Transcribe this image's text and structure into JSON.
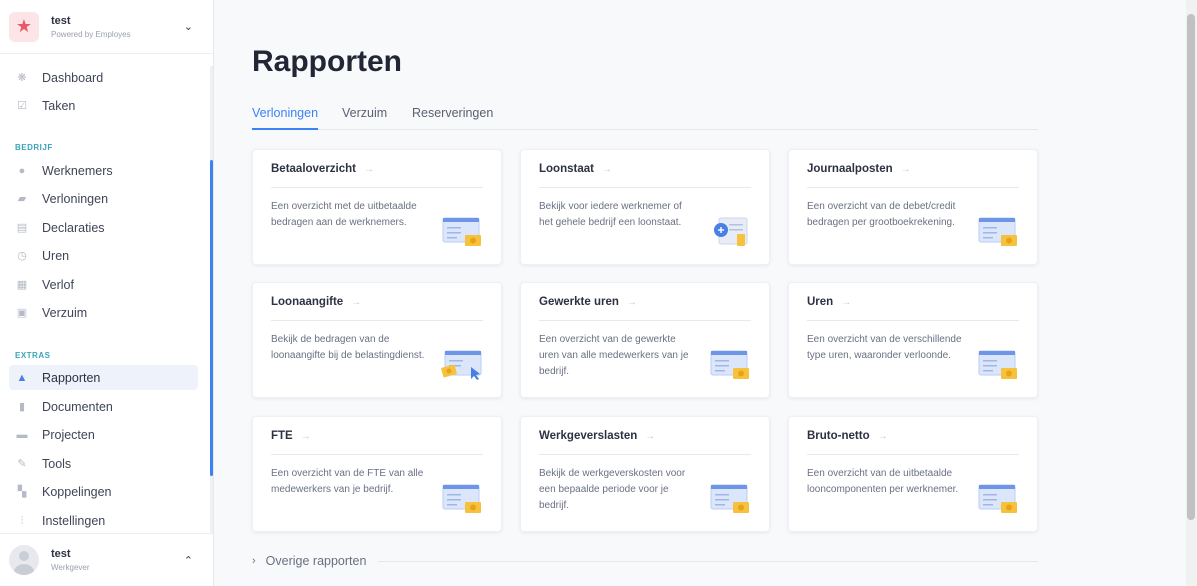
{
  "org": {
    "name": "test",
    "subtitle": "Powered by Employes"
  },
  "nav": {
    "top": [
      {
        "label": "Dashboard",
        "icon": "dashboard-icon"
      },
      {
        "label": "Taken",
        "icon": "checkbox-icon"
      }
    ],
    "section_bedrijf": "BEDRIJF",
    "bedrijf": [
      {
        "label": "Werknemers",
        "icon": "person-icon"
      },
      {
        "label": "Verloningen",
        "icon": "payroll-icon"
      },
      {
        "label": "Declaraties",
        "icon": "receipt-icon"
      },
      {
        "label": "Uren",
        "icon": "clock-icon"
      },
      {
        "label": "Verlof",
        "icon": "calendar-icon"
      },
      {
        "label": "Verzuim",
        "icon": "medical-bag-icon"
      }
    ],
    "section_extras": "EXTRAS",
    "extras": [
      {
        "label": "Rapporten",
        "icon": "chart-icon",
        "active": true
      },
      {
        "label": "Documenten",
        "icon": "document-icon"
      },
      {
        "label": "Projecten",
        "icon": "folder-icon"
      },
      {
        "label": "Tools",
        "icon": "wrench-icon"
      },
      {
        "label": "Koppelingen",
        "icon": "grid-plus-icon"
      },
      {
        "label": "Instellingen",
        "icon": "sliders-icon"
      }
    ]
  },
  "user": {
    "name": "test",
    "role": "Werkgever"
  },
  "page": {
    "title": "Rapporten",
    "tabs": [
      {
        "label": "Verloningen",
        "active": true
      },
      {
        "label": "Verzuim"
      },
      {
        "label": "Reserveringen"
      }
    ],
    "cards": [
      {
        "title": "Betaaloverzicht",
        "desc": "Een overzicht met de uitbetaalde bedragen aan de werknemers."
      },
      {
        "title": "Loonstaat",
        "desc": "Bekijk voor iedere werknemer of het gehele bedrijf een loonstaat."
      },
      {
        "title": "Journaalposten",
        "desc": "Een overzicht van de debet/credit bedragen per grootboekrekening."
      },
      {
        "title": "Loonaangifte",
        "desc": "Bekijk de bedragen van de loonaangifte bij de belastingdienst."
      },
      {
        "title": "Gewerkte uren",
        "desc": "Een overzicht van de gewerkte uren van alle medewerkers van je bedrijf."
      },
      {
        "title": "Uren",
        "desc": "Een overzicht van de verschillende type uren, waaronder verloonde."
      },
      {
        "title": "FTE",
        "desc": "Een overzicht van de FTE van alle medewerkers van je bedrijf."
      },
      {
        "title": "Werkgeverslasten",
        "desc": "Bekijk de werkgeverskosten voor een bepaalde periode voor je bedrijf."
      },
      {
        "title": "Bruto-netto",
        "desc": "Een overzicht van de uitbetaalde looncomponenten per werknemer."
      }
    ],
    "more_label": "Overige rapporten"
  },
  "colors": {
    "accent": "#3b82f6",
    "section": "#3aa5b8",
    "logo": "#e8596b"
  }
}
